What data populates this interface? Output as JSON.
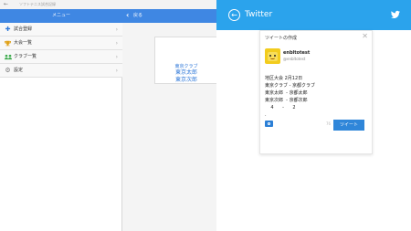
{
  "app": {
    "titlebar": {
      "back": "←",
      "title": "ソフトテニス試合記録"
    },
    "menu": {
      "header": "メニュー",
      "items": [
        {
          "label": "試合登録",
          "icon": "plus-icon"
        },
        {
          "label": "大会一覧",
          "icon": "trophy-icon"
        },
        {
          "label": "クラブ一覧",
          "icon": "people-icon"
        },
        {
          "label": "設定",
          "icon": "gear-icon"
        }
      ]
    },
    "detail": {
      "back_label": "戻る",
      "match": {
        "club": "東京クラブ",
        "player1": "東京太郎",
        "player2": "東京次郎"
      }
    }
  },
  "share": {
    "title": "Twitter",
    "card": {
      "title": "ツイートの作成",
      "user_name": "enbltotest",
      "user_handle": "@enbltotest",
      "lines": [
        "地区大会 2月12日",
        "東京クラブ - 京都クラブ",
        "東京太郎  - 京都太郎",
        "東京次郎  - 京都次郎",
        "    4      -      2",
        "."
      ],
      "char_count": "76",
      "tweet_button": "ツイート"
    }
  },
  "colors": {
    "app_blue": "#3f87e3",
    "twitter_blue": "#2ba3ec",
    "link_blue": "#2f78d8"
  }
}
